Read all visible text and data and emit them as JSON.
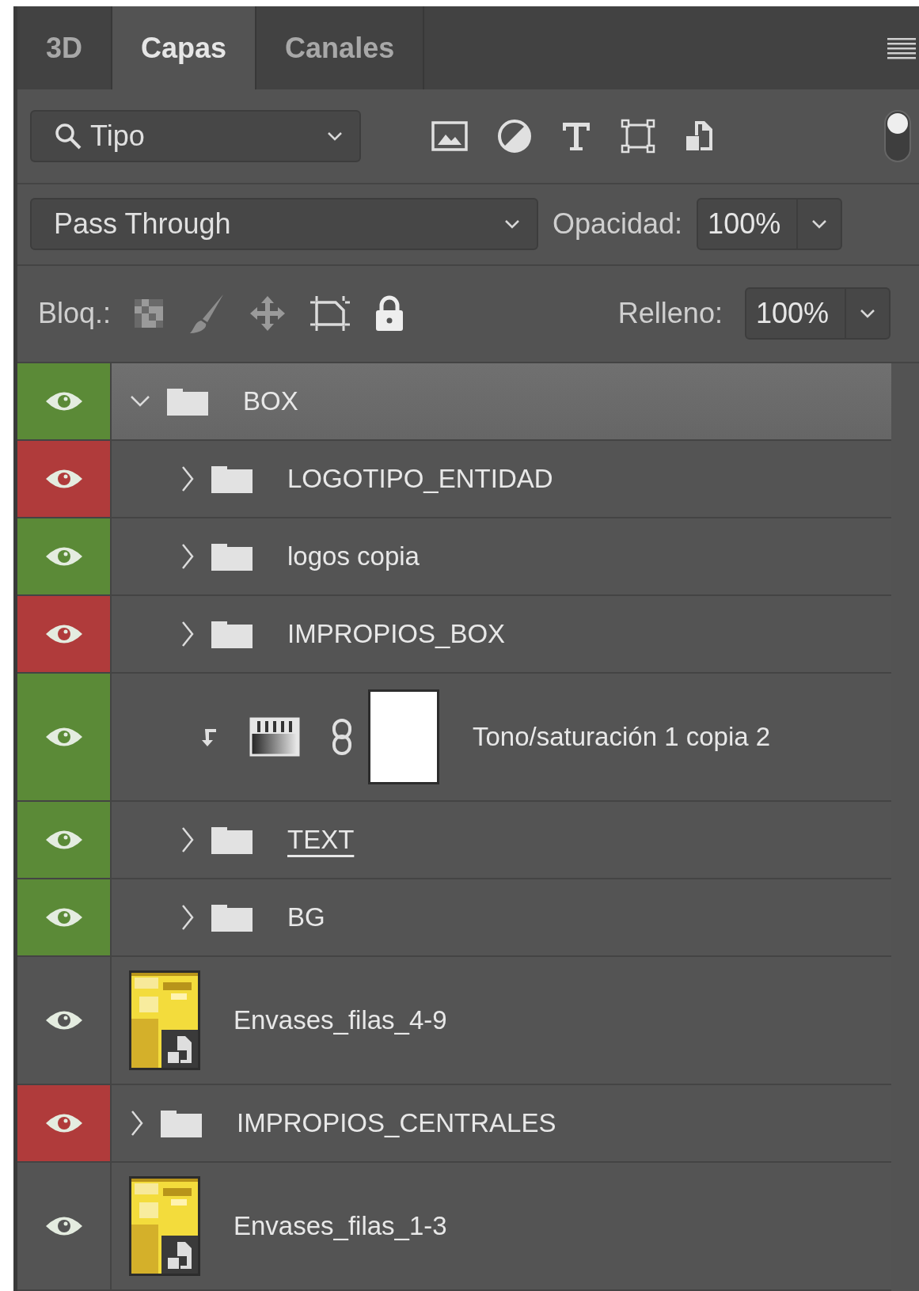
{
  "tabs": [
    {
      "label": "3D",
      "selected": false
    },
    {
      "label": "Capas",
      "selected": true
    },
    {
      "label": "Canales",
      "selected": false
    }
  ],
  "filter": {
    "value": "Tipo",
    "enabled": true
  },
  "blend": {
    "mode": "Pass Through",
    "opacity_label": "Opacidad:",
    "opacity": "100%"
  },
  "lock": {
    "label": "Bloq.:",
    "fill_label": "Relleno:",
    "fill": "100%"
  },
  "layers": [
    {
      "kind": "group",
      "name": "BOX",
      "color": "#5b8a37",
      "selected": true,
      "expanded": true,
      "underlined": false,
      "children": [
        {
          "kind": "group",
          "name": "LOGOTIPO_ENTIDAD",
          "color": "#b03b3b",
          "selected": false,
          "expanded": false,
          "underlined": false
        },
        {
          "kind": "group",
          "name": "logos copia",
          "color": "#5b8a37",
          "selected": false,
          "expanded": false,
          "underlined": false
        },
        {
          "kind": "group",
          "name": "IMPROPIOS_BOX",
          "color": "#b03b3b",
          "selected": false,
          "expanded": false,
          "underlined": false
        },
        {
          "kind": "adjustment",
          "name": "Tono/saturación 1 copia 2",
          "color": "#5b8a37",
          "selected": false,
          "underlined": false
        },
        {
          "kind": "group",
          "name": "TEXT ",
          "color": "#5b8a37",
          "selected": false,
          "expanded": false,
          "underlined": true
        },
        {
          "kind": "group",
          "name": "BG",
          "color": "#5b8a37",
          "selected": false,
          "expanded": false,
          "underlined": false
        }
      ]
    },
    {
      "kind": "smart_object",
      "name": "Envases_filas_4-9",
      "selected": false,
      "underlined": false
    },
    {
      "kind": "group",
      "name": "IMPROPIOS_CENTRALES",
      "color": "#b03b3b",
      "selected": false,
      "expanded": false,
      "underlined": false
    },
    {
      "kind": "smart_object",
      "name": "Envases_filas_1-3",
      "selected": false,
      "underlined": false
    }
  ]
}
